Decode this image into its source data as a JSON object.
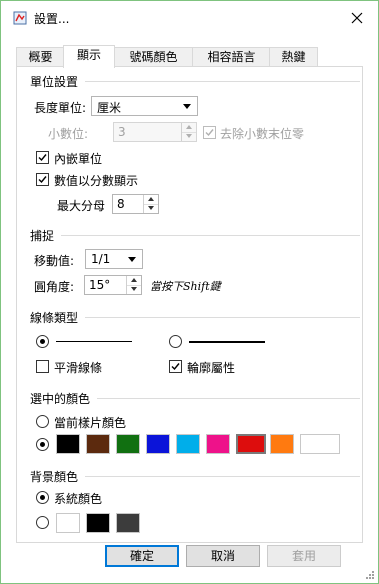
{
  "window": {
    "title": "設置..."
  },
  "tabs": [
    {
      "label": "概要"
    },
    {
      "label": "顯示"
    },
    {
      "label": "號碼顏色"
    },
    {
      "label": "相容語言"
    },
    {
      "label": "熱鍵"
    }
  ],
  "active_tab": "顯示",
  "units": {
    "section_title": "單位設置",
    "length_unit_label": "長度單位:",
    "length_unit_value": "厘米",
    "decimals_label": "小數位:",
    "decimals_value": "3",
    "remove_zeros_label": "去除小數末位零",
    "remove_zeros_checked": true,
    "embed_units_label": "內嵌單位",
    "embed_units_checked": true,
    "fraction_label": "數值以分數顯示",
    "fraction_checked": true,
    "max_denominator_label": "最大分母",
    "max_denominator_value": "8"
  },
  "snap": {
    "section_title": "捕捉",
    "move_label": "移動值:",
    "move_value": "1/1",
    "angle_label": "圓角度:",
    "angle_value": "15°",
    "hint": "當按下Shift鍵"
  },
  "line_type": {
    "section_title": "線條類型",
    "option1_selected": true,
    "option2_selected": false,
    "smooth_label": "平滑線條",
    "smooth_checked": false,
    "outline_label": "輪廓屬性",
    "outline_checked": true
  },
  "selected_color": {
    "section_title": "選中的顏色",
    "current_tile_label": "當前樣片顏色",
    "current_tile_selected": false,
    "custom_selected": true,
    "swatches": [
      "#000000",
      "#5c2a0e",
      "#117011",
      "#0b14d9",
      "#00aeea",
      "#ee128a",
      "#dd0d0d",
      "#ff7a10",
      "#ffffff"
    ],
    "selected_swatch_index": 6
  },
  "background": {
    "section_title": "背景顏色",
    "system_label": "系統顏色",
    "system_selected": true,
    "custom_selected": false,
    "swatches": [
      "#ffffff",
      "#000000",
      "#3c3c3c"
    ]
  },
  "buttons": {
    "ok": "確定",
    "cancel": "取消",
    "apply": "套用"
  },
  "colors": {
    "window_border": "#7fc37f",
    "default_button_border": "#0078d7"
  }
}
